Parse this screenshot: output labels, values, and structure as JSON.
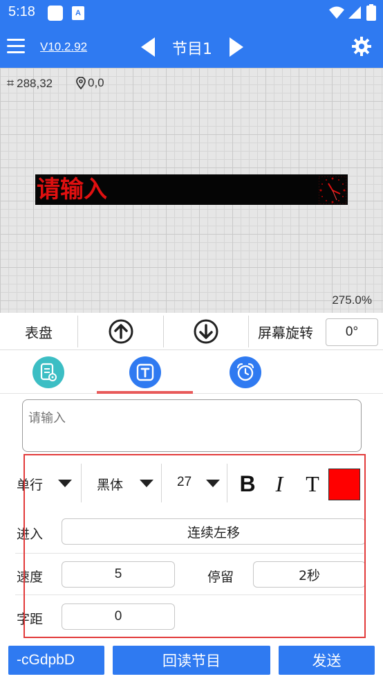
{
  "status_bar": {
    "time": "5:18",
    "notif_icon_label": "A"
  },
  "toolbar": {
    "version": "V10.2.92",
    "program_title": "节目1"
  },
  "canvas": {
    "grid_coords": "288,32",
    "position": "0,0",
    "led_text": "请输入",
    "zoom": "275.0%"
  },
  "action_row": {
    "dial_label": "表盘",
    "rotate_label": "屏幕旋转",
    "rotation_value": "0°"
  },
  "text_input": {
    "placeholder": "请输入"
  },
  "format": {
    "line_mode": "单行",
    "font_name": "黑体",
    "font_size": "27",
    "bold_glyph": "B",
    "italic_glyph": "I",
    "text_glyph": "T",
    "color": "#ff0000"
  },
  "effects": {
    "enter_label": "进入",
    "enter_value": "连续左移",
    "speed_label": "速度",
    "speed_value": "5",
    "stay_label": "停留",
    "stay_value": "2秒",
    "spacing_label": "字距",
    "spacing_value": "0"
  },
  "bottom": {
    "device_label": "-cGdpbD",
    "readback_label": "回读节目",
    "send_label": "发送"
  }
}
